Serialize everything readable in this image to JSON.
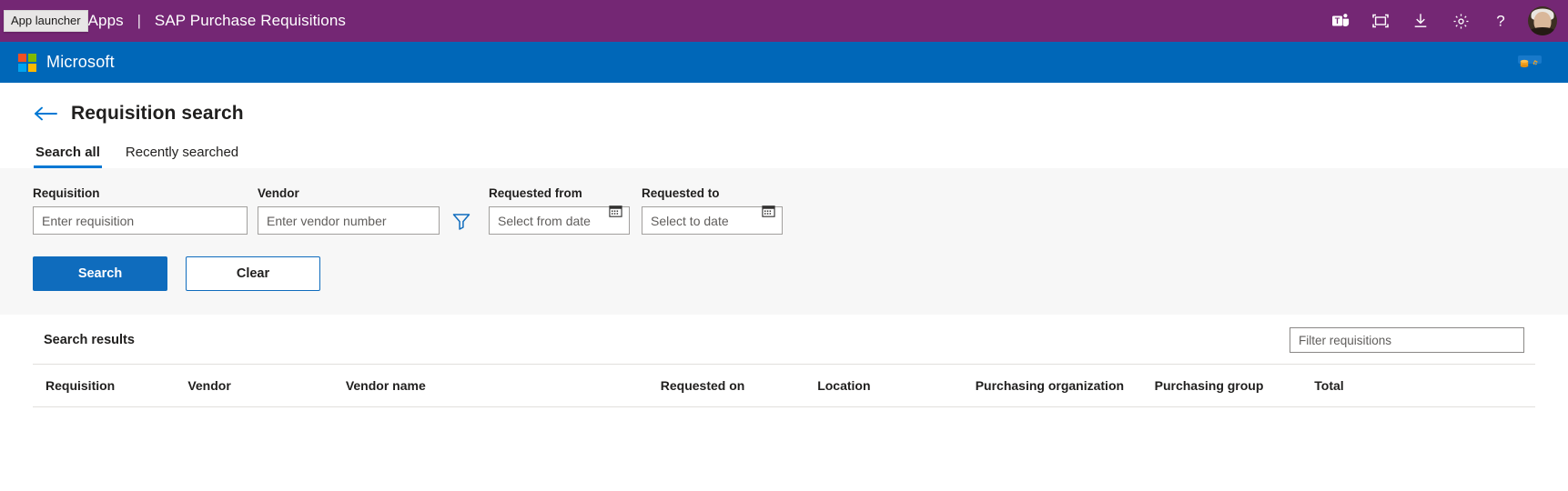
{
  "topbar": {
    "app_launcher_tooltip": "App launcher",
    "brand": "Power Apps",
    "separator": "|",
    "app_name": "SAP Purchase Requisitions",
    "icons": [
      {
        "name": "teams-icon",
        "label": "Microsoft Teams"
      },
      {
        "name": "fullscreen-icon",
        "label": "Full screen"
      },
      {
        "name": "download-icon",
        "label": "Download"
      },
      {
        "name": "gear-icon",
        "label": "Settings"
      },
      {
        "name": "help-icon",
        "label": "Help"
      }
    ],
    "avatar_label": "Account manager",
    "background_color": "#742774"
  },
  "msbar": {
    "logo_text": "Microsoft",
    "env_icon_label": "environment-icon",
    "background_color": "#0067b8"
  },
  "page": {
    "back_label": "Back",
    "title": "Requisition search",
    "tabs": [
      {
        "label": "Search all",
        "active": true
      },
      {
        "label": "Recently searched",
        "active": false
      }
    ]
  },
  "search_form": {
    "requisition": {
      "label": "Requisition",
      "placeholder": "Enter requisition",
      "value": ""
    },
    "vendor": {
      "label": "Vendor",
      "placeholder": "Enter vendor number",
      "value": ""
    },
    "filter_icon_label": "filter-funnel-icon",
    "requested_from": {
      "label": "Requested from",
      "placeholder": "Select from date",
      "value": ""
    },
    "requested_to": {
      "label": "Requested to",
      "placeholder": "Select to date",
      "value": ""
    },
    "search_button": "Search",
    "clear_button": "Clear",
    "accent_color": "#0f6cbd"
  },
  "results": {
    "title": "Search results",
    "filter_placeholder": "Filter requisitions",
    "filter_value": "",
    "columns": [
      "Requisition",
      "Vendor",
      "Vendor name",
      "Requested on",
      "Location",
      "Purchasing organization",
      "Purchasing group",
      "Total"
    ],
    "rows": []
  }
}
